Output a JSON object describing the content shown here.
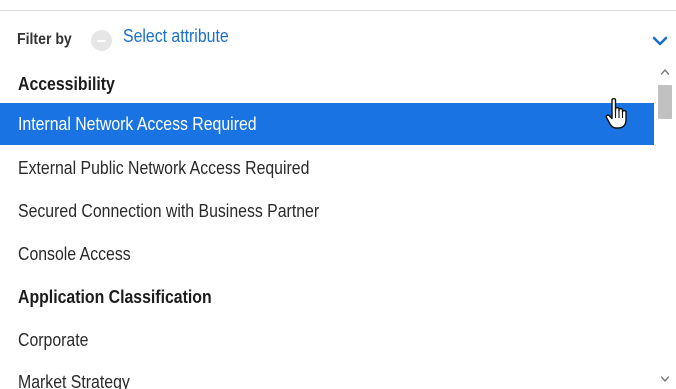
{
  "filter": {
    "label": "Filter by",
    "select_placeholder": "Select attribute",
    "clear_icon": "minus-circle-icon",
    "expand_icon": "chevron-down-icon"
  },
  "colors": {
    "accent": "#1a6fcf",
    "selected_bg": "#1a73e2",
    "selected_text": "#ffffff"
  },
  "list": {
    "items": [
      {
        "type": "group",
        "label": "Accessibility"
      },
      {
        "type": "option",
        "label": "Internal Network Access Required",
        "selected": true
      },
      {
        "type": "option",
        "label": "External Public Network Access Required"
      },
      {
        "type": "option",
        "label": "Secured Connection with Business Partner"
      },
      {
        "type": "option",
        "label": "Console Access"
      },
      {
        "type": "group",
        "label": "Application Classification"
      },
      {
        "type": "option",
        "label": "Corporate"
      },
      {
        "type": "option",
        "label": "Market Strategy"
      }
    ]
  },
  "cursor": {
    "icon": "hand-pointer-icon"
  }
}
